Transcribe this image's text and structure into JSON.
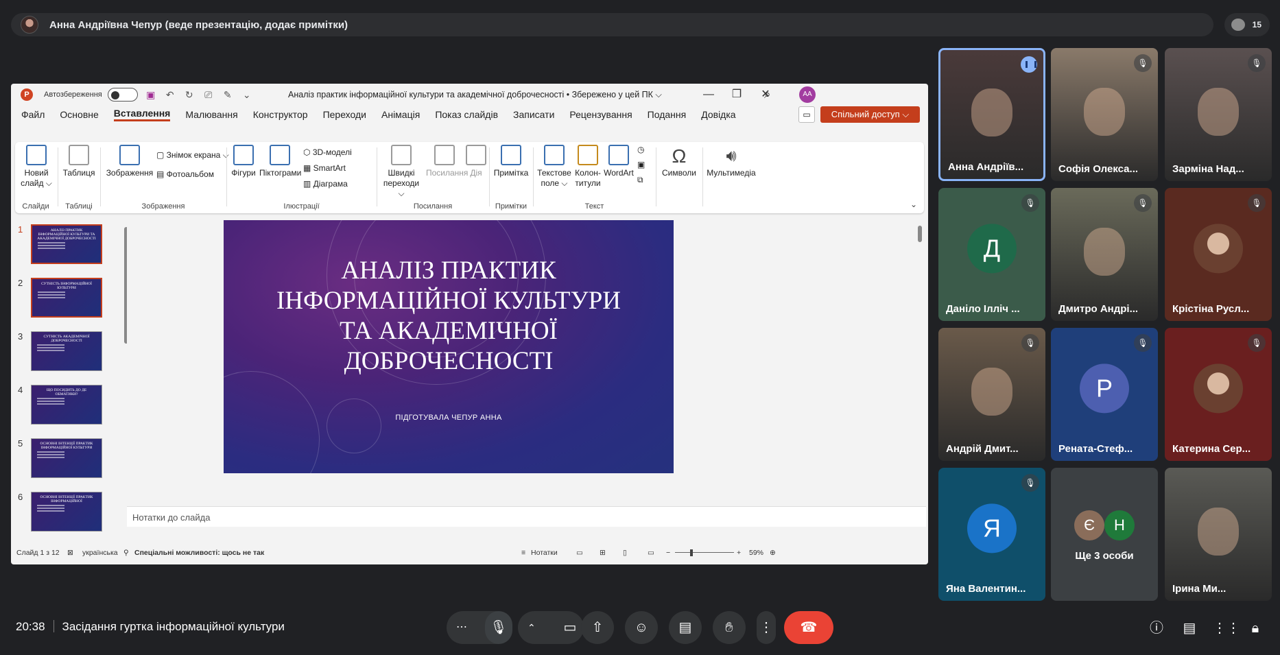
{
  "presenter_bar": {
    "text": "Анна Андріївна Чепур (веде презентацію, додає примітки)",
    "participant_count": "15"
  },
  "ppt": {
    "autosave_label": "Автозбереження",
    "doc_title": "Аналіз практик інформаційної культури та академічної доброчесності • Збережено у цей ПК ⌵",
    "user_initials": "AA",
    "menu_tabs": [
      "Файл",
      "Основне",
      "Вставлення",
      "Малювання",
      "Конструктор",
      "Переходи",
      "Анімація",
      "Показ слайдів",
      "Записати",
      "Рецензування",
      "Подання",
      "Довідка"
    ],
    "active_tab": "Вставлення",
    "share_label": "Спільний доступ ⌵",
    "ribbon": {
      "new_slide": "Новий слайд ⌵",
      "table": "Таблиця",
      "images": "Зображення",
      "screenshot": "Знімок екрана ⌵",
      "photo_album": "Фотоальбом",
      "shapes": "Фігури",
      "icons": "Піктограми",
      "models3d": "3D-моделі",
      "smartart": "SmartArt",
      "chart": "Діаграма",
      "quick_links": "Швидкі переходи ⌵",
      "link": "Посилання",
      "action": "Дія",
      "comment": "Примітка",
      "textbox": "Текстове поле ⌵",
      "header_footer": "Колон-титули",
      "wordart": "WordArt",
      "symbols": "Символи",
      "media": "Мультимедіа",
      "groups": {
        "slides": "Слайди",
        "tables": "Таблиці",
        "images": "Зображення",
        "illustrations": "Ілюстрації",
        "links": "Посилання",
        "comments": "Примітки",
        "text": "Текст"
      }
    },
    "thumbnails": [
      {
        "num": "1",
        "title": "АНАЛІЗ ПРАКТИК ІНФОРМАЦІЙНОЇ КУЛЬТУРИ ТА АКАДЕМІЧНОЇ ДОБРОЧЕСНОСТІ"
      },
      {
        "num": "2",
        "title": "СУТНІСТЬ ІНФОРМАЦІЙНОЇ КУЛЬТУРИ"
      },
      {
        "num": "3",
        "title": "СУТНІСТЬ АКАДЕМІЧНОЇ ДОБРОЧЕСНОСТІ"
      },
      {
        "num": "4",
        "title": "ЩО ПОСИДИТЬ ДО ДЕ ОБМАТИКИ?"
      },
      {
        "num": "5",
        "title": "ОСНОВНІ ІНТЕНЦІЇ ПРАКТИК ІНФОРМАЦІЙНОЇ КУЛЬТУРИ"
      },
      {
        "num": "6",
        "title": "ОСНОВНІ ІНТЕНЦІЇ ПРАКТИК ІНФОРМАЦІЙНОЇ"
      }
    ],
    "slide": {
      "title_lines": [
        "АНАЛІЗ ПРАКТИК",
        "ІНФОРМАЦІЙНОЇ КУЛЬТУРИ",
        "ТА АКАДЕМІЧНОЇ",
        "ДОБРОЧЕСНОСТІ"
      ],
      "subtitle": "ПІДГОТУВАЛА ЧЕПУР АННА"
    },
    "notes_placeholder": "Нотатки до слайда",
    "status": {
      "slide_info": "Слайд 1 з 12",
      "language": "українська",
      "accessibility": "Спеціальні можливості: щось не так",
      "notes": "Нотатки",
      "zoom": "59%"
    }
  },
  "tiles": [
    {
      "name": "Анна Андріїв...",
      "type": "video",
      "active": true
    },
    {
      "name": "Софія Олекса...",
      "type": "video",
      "muted": true
    },
    {
      "name": "Зарміна Над...",
      "type": "video",
      "muted": true
    },
    {
      "name": "Даніло Ілліч ...",
      "type": "letter",
      "letter": "Д",
      "muted": true
    },
    {
      "name": "Дмитро Андрі...",
      "type": "video",
      "muted": true
    },
    {
      "name": "Крістіна Русл...",
      "type": "photo",
      "muted": true
    },
    {
      "name": "Андрій Дмит...",
      "type": "video",
      "muted": true
    },
    {
      "name": "Рената-Стеф...",
      "type": "letter",
      "letter": "Р",
      "muted": true
    },
    {
      "name": "Катерина Сер...",
      "type": "photo",
      "muted": true
    },
    {
      "name": "Яна Валентин...",
      "type": "letter",
      "letter": "Я",
      "muted": true
    },
    {
      "name": "Ще 3 особи",
      "type": "more",
      "letters": [
        "Є",
        "Н"
      ]
    },
    {
      "name": "Ірина Ми...",
      "type": "video"
    }
  ],
  "colors": {
    "accent": "#c43e1c",
    "end_call": "#ea4335",
    "speaking": "#8ab4f8"
  },
  "bottom": {
    "time": "20:38",
    "meeting_title": "Засідання гуртка інформаційної культури"
  }
}
